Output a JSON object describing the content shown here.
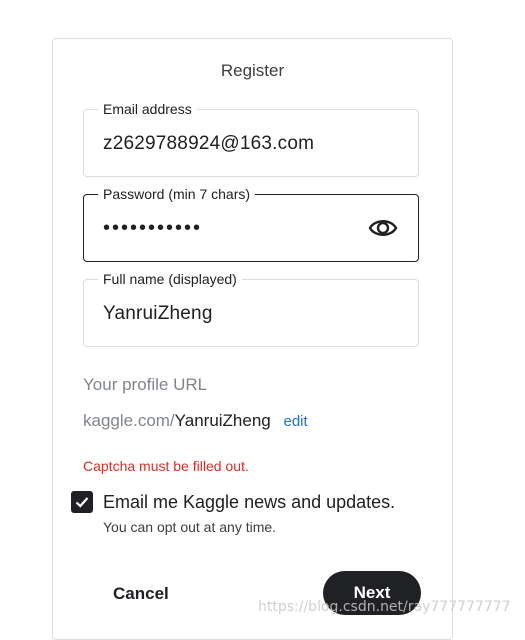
{
  "form": {
    "title": "Register",
    "email": {
      "label": "Email address",
      "value": "z2629788924@163.com"
    },
    "password": {
      "label": "Password (min 7 chars)",
      "masked_value": "•••••••••••",
      "toggle_icon": "eye-icon"
    },
    "full_name": {
      "label": "Full name (displayed)",
      "value": "YanruiZheng"
    },
    "profile_url": {
      "label": "Your profile URL",
      "prefix": "kaggle.com/",
      "handle": "YanruiZheng",
      "edit_label": "edit"
    },
    "error": "Captcha must be filled out.",
    "newsletter": {
      "checked": true,
      "label": "Email me Kaggle news and updates.",
      "sublabel": "You can opt out at any time."
    },
    "cancel_label": "Cancel",
    "next_label": "Next"
  },
  "watermark": "https://blog.csdn.net/ray777777777",
  "colors": {
    "primary": "#202124",
    "link": "#1a73e8",
    "error": "#d93025",
    "muted": "#80868b",
    "border": "#dadce0"
  }
}
